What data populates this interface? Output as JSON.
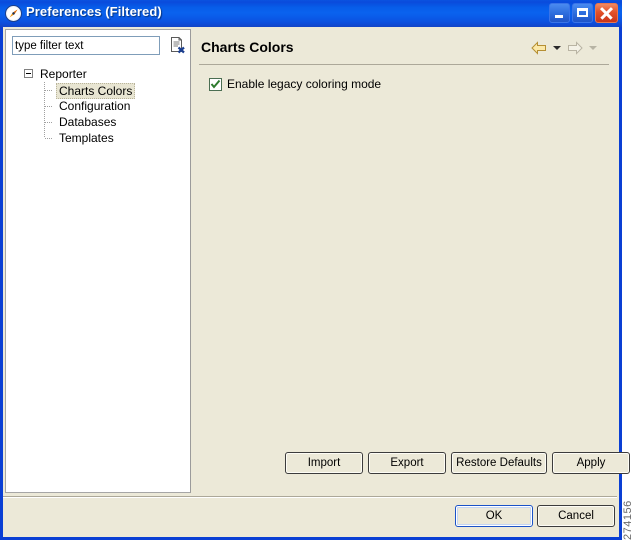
{
  "window": {
    "title": "Preferences (Filtered)",
    "icon": "preferences-compass-icon",
    "minimize_label": "Minimize",
    "maximize_label": "Maximize",
    "close_label": "Close",
    "titlebar_color": "#0a5ae8",
    "dialog_bg_color": "#ece9d8"
  },
  "filter": {
    "value": "type filter text",
    "placeholder": "type filter text",
    "clear_icon": "clear-filter-icon"
  },
  "tree": {
    "root": {
      "label": "Reporter",
      "expanded": true,
      "children": [
        {
          "label": "Charts Colors",
          "selected": true
        },
        {
          "label": "Configuration",
          "selected": false
        },
        {
          "label": "Databases",
          "selected": false
        },
        {
          "label": "Templates",
          "selected": false
        }
      ]
    }
  },
  "page": {
    "title": "Charts Colors",
    "back_label": "Back",
    "back_dropdown_label": "Back history",
    "forward_label": "Forward",
    "options": [
      {
        "label": "Enable legacy coloring mode",
        "checked": true
      }
    ]
  },
  "buttons": {
    "import": "Import",
    "export": "Export",
    "restore_defaults": "Restore Defaults",
    "apply": "Apply",
    "ok": "OK",
    "cancel": "Cancel"
  },
  "watermark": "274156"
}
